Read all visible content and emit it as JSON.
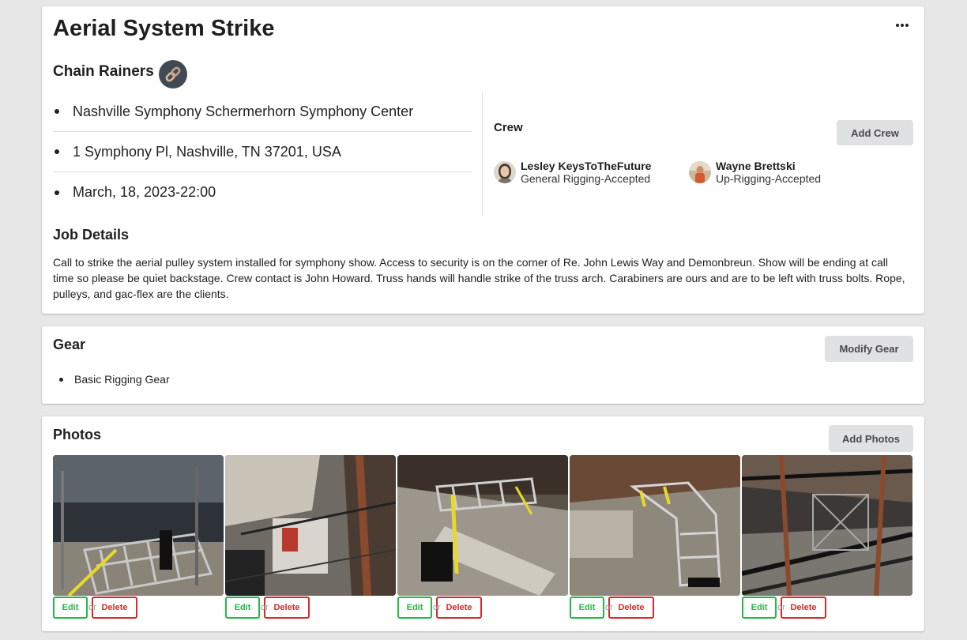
{
  "job": {
    "title": "Aerial System Strike",
    "company": "Chain Rainers",
    "company_logo_icon": "chain-link-icon",
    "menu_icon": "ellipsis-icon",
    "venue": "Nashville Symphony Schermerhorn Symphony Center",
    "address": "1 Symphony Pl, Nashville, TN 37201, USA",
    "datetime": "March, 18, 2023-22:00",
    "details_heading": "Job Details",
    "details": "Call to strike the aerial pulley system installed for symphony show. Access to security is on the corner of Re. John Lewis Way and Demonbreun. Show will be ending at call time so please be quiet backstage. Crew contact is John Howard. Truss hands will handle strike of the truss arch. Carabiners are ours and are to be left with truss bolts. Rope, pulleys, and gac-flex are the clients."
  },
  "crew": {
    "heading": "Crew",
    "add_label": "Add Crew",
    "members": [
      {
        "name": "Lesley KeysToTheFuture",
        "role": "General Rigging-Accepted"
      },
      {
        "name": "Wayne Brettski",
        "role": "Up-Rigging-Accepted"
      }
    ]
  },
  "gear": {
    "heading": "Gear",
    "modify_label": "Modify Gear",
    "items": [
      "Basic Rigging Gear"
    ]
  },
  "photos": {
    "heading": "Photos",
    "add_label": "Add Photos",
    "edit_label": "Edit",
    "or_label": "or",
    "delete_label": "Delete",
    "count": 5
  },
  "colors": {
    "edit": "#21ba45",
    "delete": "#db2828",
    "grey_button": "#e0e1e2",
    "background": "#e7e7e7",
    "logo_bg": "#3f4a55"
  }
}
